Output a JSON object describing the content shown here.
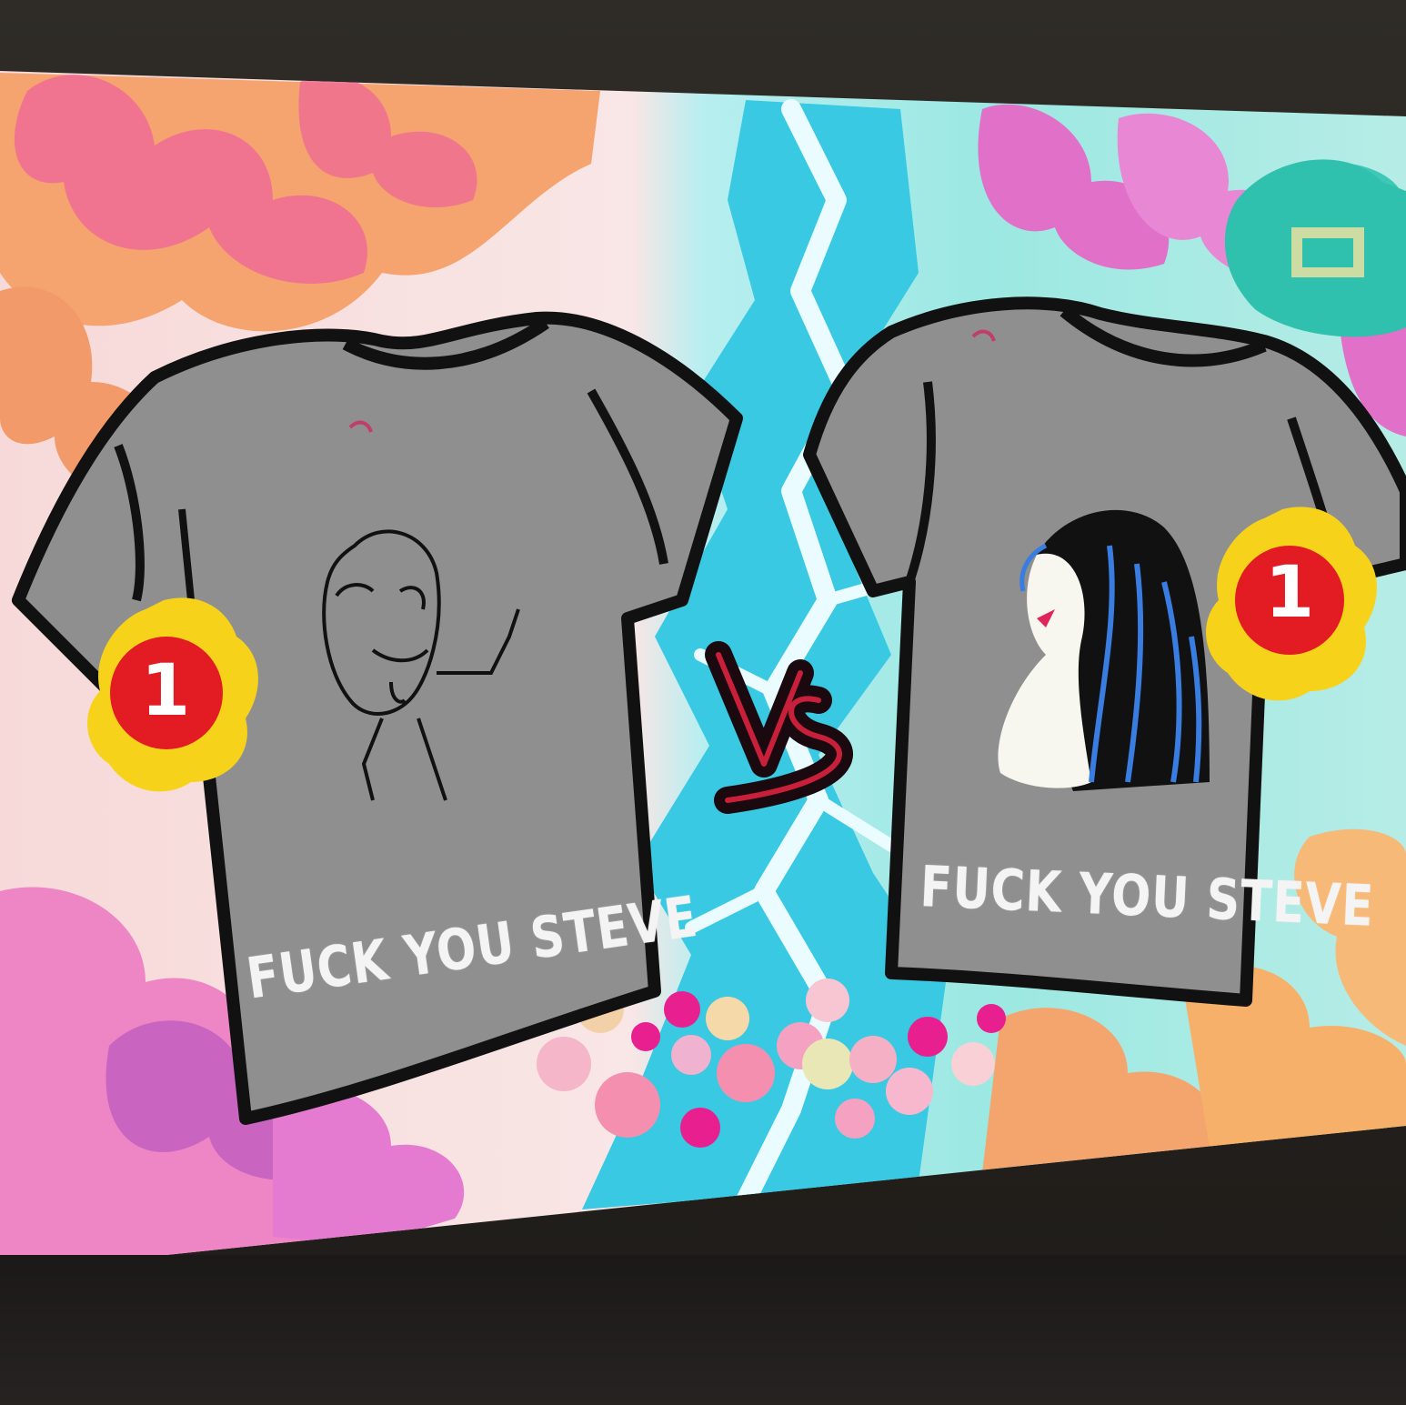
{
  "left_entry": {
    "caption": "FUCK YOU STEVE",
    "votes": "1",
    "shirt_color": "#8f8f8f"
  },
  "right_entry": {
    "caption": "FUCK YOU STEVE",
    "votes": "1",
    "shirt_color": "#8f8f8f"
  },
  "versus_label": "VS",
  "colors": {
    "badge_red": "#e31b23",
    "badge_yellow": "#f7d21b",
    "lightning": "#3fd3e8",
    "left_bg_flower": "#f28bb0",
    "right_bg_flower": "#e070c8"
  }
}
